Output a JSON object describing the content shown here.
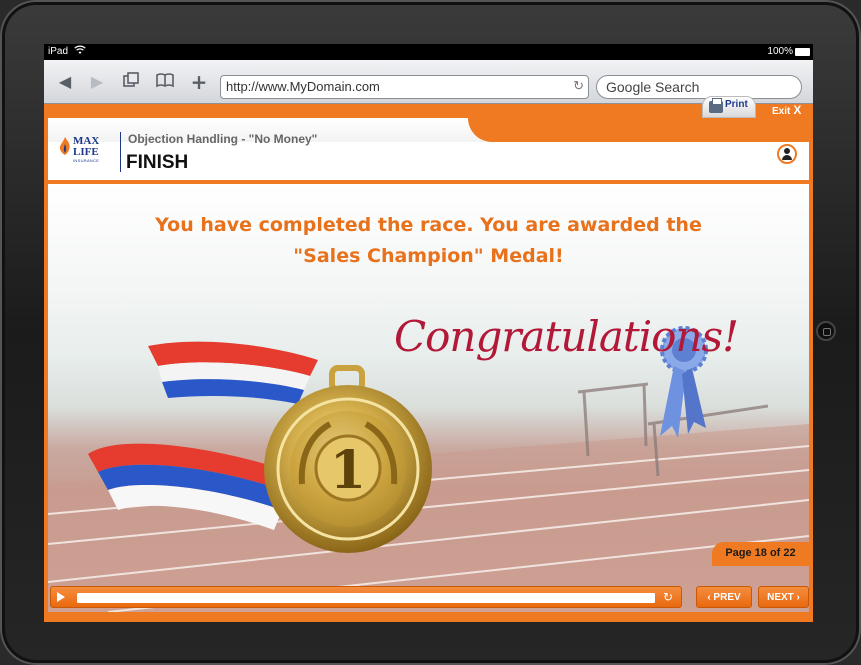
{
  "status_bar": {
    "device": "iPad",
    "battery": "100%"
  },
  "browser": {
    "url": "http://www.MyDomain.com",
    "search_placeholder": "Google Search"
  },
  "course": {
    "logo_line1": "MAX",
    "logo_line2": "LIFE",
    "logo_line3": "INSURANCE",
    "module_title": "Objection Handling - \"No Money\"",
    "section_title": "FINISH",
    "print_label": "Print",
    "exit_label": "Exit",
    "exit_symbol": "X",
    "headline_line1": "You have completed the race. You are awarded the",
    "headline_line2": "\"Sales Champion\" Medal!",
    "congrats_text": "Congratulations!",
    "medal_number": "1",
    "page_indicator": "Page 18 of 22",
    "prev_label": "‹ PREV",
    "next_label": "NEXT ›"
  },
  "colors": {
    "accent": "#f07a21",
    "headline": "#e8711c",
    "brand_blue": "#1d3a8a",
    "congrats": "#b21938"
  },
  "icons": [
    "back-icon",
    "forward-icon",
    "tabs-icon",
    "bookmarks-icon",
    "add-icon",
    "reload-icon",
    "printer-icon",
    "close-icon",
    "user-icon",
    "play-icon",
    "replay-icon",
    "wifi-icon",
    "battery-icon"
  ]
}
